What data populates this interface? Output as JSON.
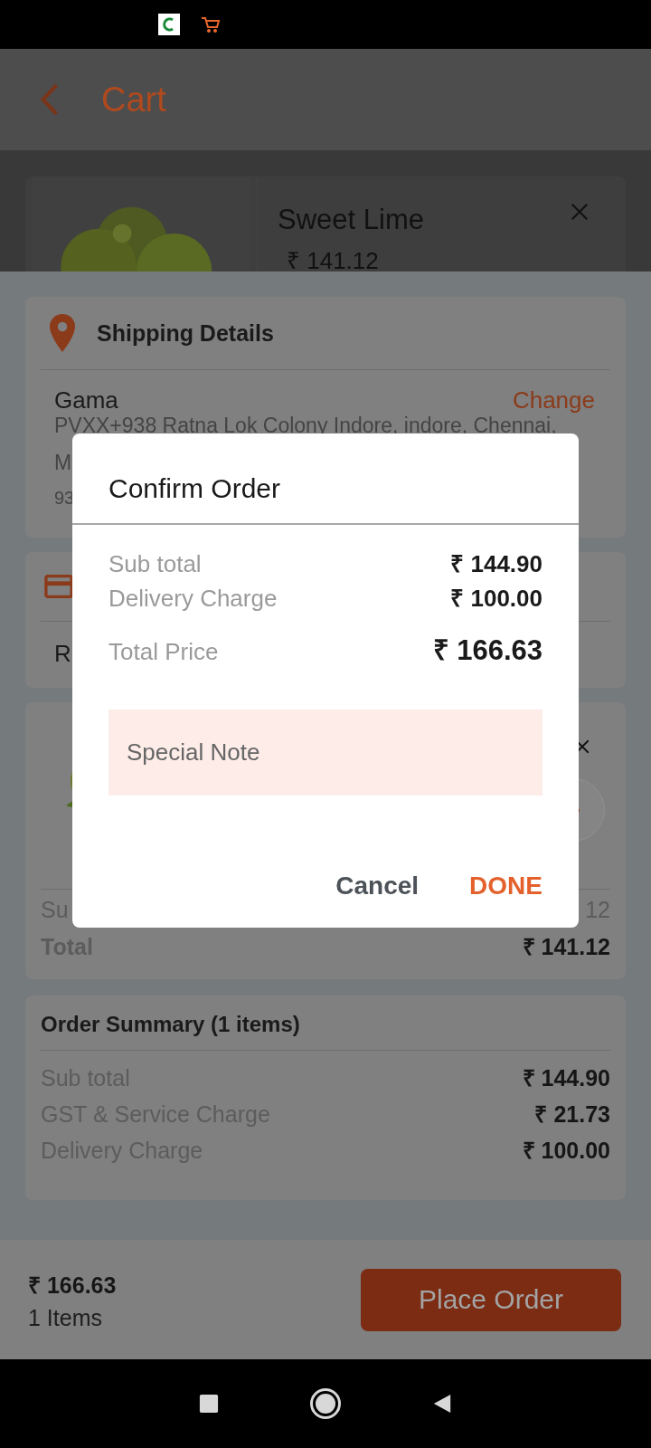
{
  "header": {
    "title": "Cart"
  },
  "cart_item": {
    "name": "Sweet Lime",
    "price": "₹ 141.12"
  },
  "shipping": {
    "title": "Shipping Details",
    "name": "Gama",
    "action": "Change",
    "address": "PVXX+938 Ratna Lok Colony Indore, indore, Chennai,",
    "address_cont": "M",
    "phone": "93"
  },
  "payment": {
    "text": "R"
  },
  "product": {
    "subtotal_label": "Su",
    "subtotal_value": "12",
    "total_label": "Total",
    "total_value": "₹ 141.12"
  },
  "order_summary": {
    "title": "Order Summary (1 items)",
    "rows": [
      {
        "label": "Sub total",
        "value": "₹ 144.90"
      },
      {
        "label": "GST & Service Charge",
        "value": "₹ 21.73"
      },
      {
        "label": "Delivery Charge",
        "value": "₹ 100.00"
      }
    ]
  },
  "footer": {
    "total": "₹ 166.63",
    "items": "1 Items",
    "button": "Place Order"
  },
  "dialog": {
    "title": "Confirm Order",
    "rows": [
      {
        "label": "Sub total",
        "value": "₹ 144.90",
        "kind": "line"
      },
      {
        "label": "Delivery Charge",
        "value": "₹ 100.00",
        "kind": "line"
      },
      {
        "label": "Total Price",
        "value": "₹ 166.63",
        "kind": "total"
      }
    ],
    "note": {
      "placeholder": "Special Note"
    },
    "buttons": [
      {
        "label": "Cancel",
        "kind": "secondary"
      },
      {
        "label": "DONE",
        "kind": "primary"
      }
    ]
  }
}
